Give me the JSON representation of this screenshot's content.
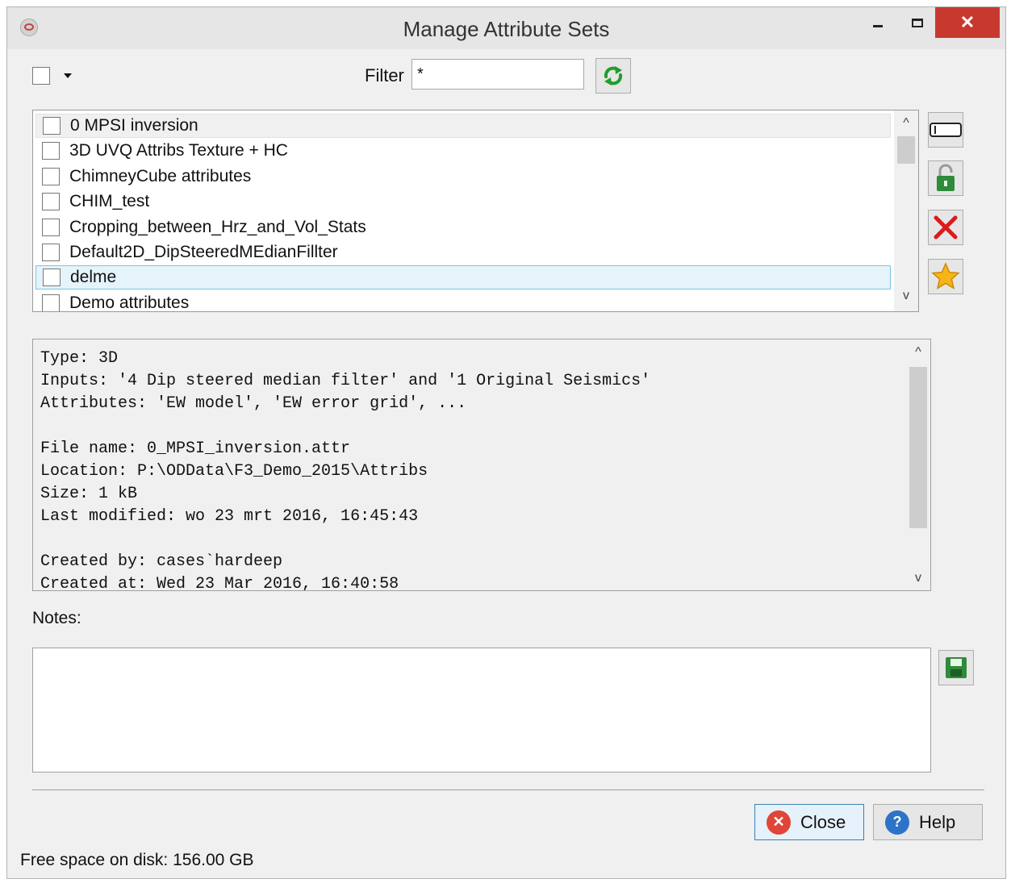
{
  "window": {
    "title": "Manage Attribute Sets",
    "close_glyph": "✕"
  },
  "toolbar": {
    "filter_label": "Filter",
    "filter_value": "*"
  },
  "list": {
    "items": [
      {
        "label": "0 MPSI inversion"
      },
      {
        "label": "3D UVQ Attribs Texture + HC"
      },
      {
        "label": "ChimneyCube attributes"
      },
      {
        "label": "CHIM_test"
      },
      {
        "label": "Cropping_between_Hrz_and_Vol_Stats"
      },
      {
        "label": "Default2D_DipSteeredMEdianFillter"
      },
      {
        "label": "delme"
      },
      {
        "label": "Demo attributes"
      }
    ]
  },
  "info": {
    "lines": [
      "Type: 3D",
      "Inputs: '4 Dip steered median filter' and '1 Original Seismics'",
      "Attributes: 'EW model', 'EW error grid', ...",
      "",
      "File name: 0_MPSI_inversion.attr",
      "Location: P:\\ODData\\F3_Demo_2015\\Attribs",
      "Size: 1 kB",
      "Last modified: wo 23 mrt 2016, 16:45:43",
      "",
      "Created by: cases`hardeep",
      "Created at: Wed 23 Mar 2016, 16:40:58"
    ]
  },
  "notes": {
    "label": "Notes:",
    "value": ""
  },
  "buttons": {
    "close_label": "Close",
    "help_label": "Help"
  },
  "status": {
    "free_space": "Free space on disk: 156.00 GB"
  },
  "scrollbar": {
    "up": "^",
    "down": "v"
  }
}
